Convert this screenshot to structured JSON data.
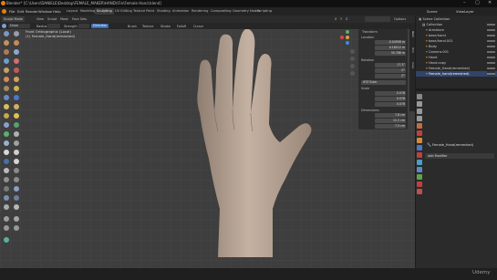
{
  "title_bar": {
    "title": "Blender* [C:\\Users\\DANIELE\\Desktop\\FEMALE_MAKER\\HAND\\\\Fin\\Female Hand.blend]"
  },
  "menu": [
    "File",
    "Edit",
    "Render",
    "Window",
    "Help"
  ],
  "workspace_tabs": [
    "Layout",
    "Modeling",
    "Sculpting",
    "UV Editing",
    "Texture Paint",
    "Shading",
    "Animation",
    "Rendering",
    "Compositing",
    "Geometry Nodes",
    "Scripting"
  ],
  "active_workspace": "Sculpting",
  "scene_label": "Scene",
  "view_layer_label": "ViewLayer",
  "header": {
    "mode": "Sculpt Mode",
    "view": "View",
    "sculpt": "Sculpt",
    "mask": "Mask",
    "face_sets": "Face Sets",
    "x_label": "X",
    "y_label": "Y",
    "z_label": "Z",
    "options": "Options"
  },
  "tool_header": {
    "brush": "Draw",
    "radius_label": "Radius",
    "strength_label": "Strength",
    "direction": "Direction",
    "brush_menu": "Brush",
    "texture_menu": "Texture",
    "stroke_menu": "Stroke",
    "falloff_menu": "Falloff",
    "cursor_menu": "Cursor"
  },
  "viewport": {
    "view_name": "Front Orthographic (Local)",
    "object_name": "(1) Female_Hand(remeshed)"
  },
  "npanel": {
    "transform_title": "Transform",
    "location_label": "Location",
    "loc": [
      "-0.04956 m",
      "0.18512 m",
      "35.786 m"
    ],
    "rotation_label": "Rotation",
    "rot": [
      "17.3°",
      "0°",
      "0°"
    ],
    "mode": "XYZ Euler",
    "scale_label": "Scale",
    "scale": [
      "0.078",
      "0.078",
      "0.078"
    ],
    "dimensions_label": "Dimensions",
    "dim": [
      "7.8 cm",
      "12.2 cm",
      "7.5 cm"
    ],
    "tabs": [
      "Item",
      "Tool",
      "View"
    ]
  },
  "outliner": {
    "rows": [
      {
        "label": "Scene Collection",
        "selected": false
      },
      {
        "label": "Collection",
        "selected": false
      },
      {
        "label": "Armature",
        "selected": false
      },
      {
        "label": "base/hand",
        "selected": false
      },
      {
        "label": "base/hand.001",
        "selected": false
      },
      {
        "label": "Body",
        "selected": false
      },
      {
        "label": "Camera.001",
        "selected": false
      },
      {
        "label": "Hand",
        "selected": false
      },
      {
        "label": "Hand.copy",
        "selected": false
      },
      {
        "label": "Female_Hand(remeshed)",
        "selected": false
      },
      {
        "label": "Female_hand(remeshed)",
        "selected": true
      }
    ]
  },
  "properties": {
    "object_name": "Female_Hand(remeshed)",
    "add_modifier": "Add Modifier"
  },
  "watermark": "Udemy",
  "colors": {
    "accent": "#3f6db0",
    "selection": "#31456b",
    "orange": "#d48a3a",
    "green": "#62a34a"
  }
}
